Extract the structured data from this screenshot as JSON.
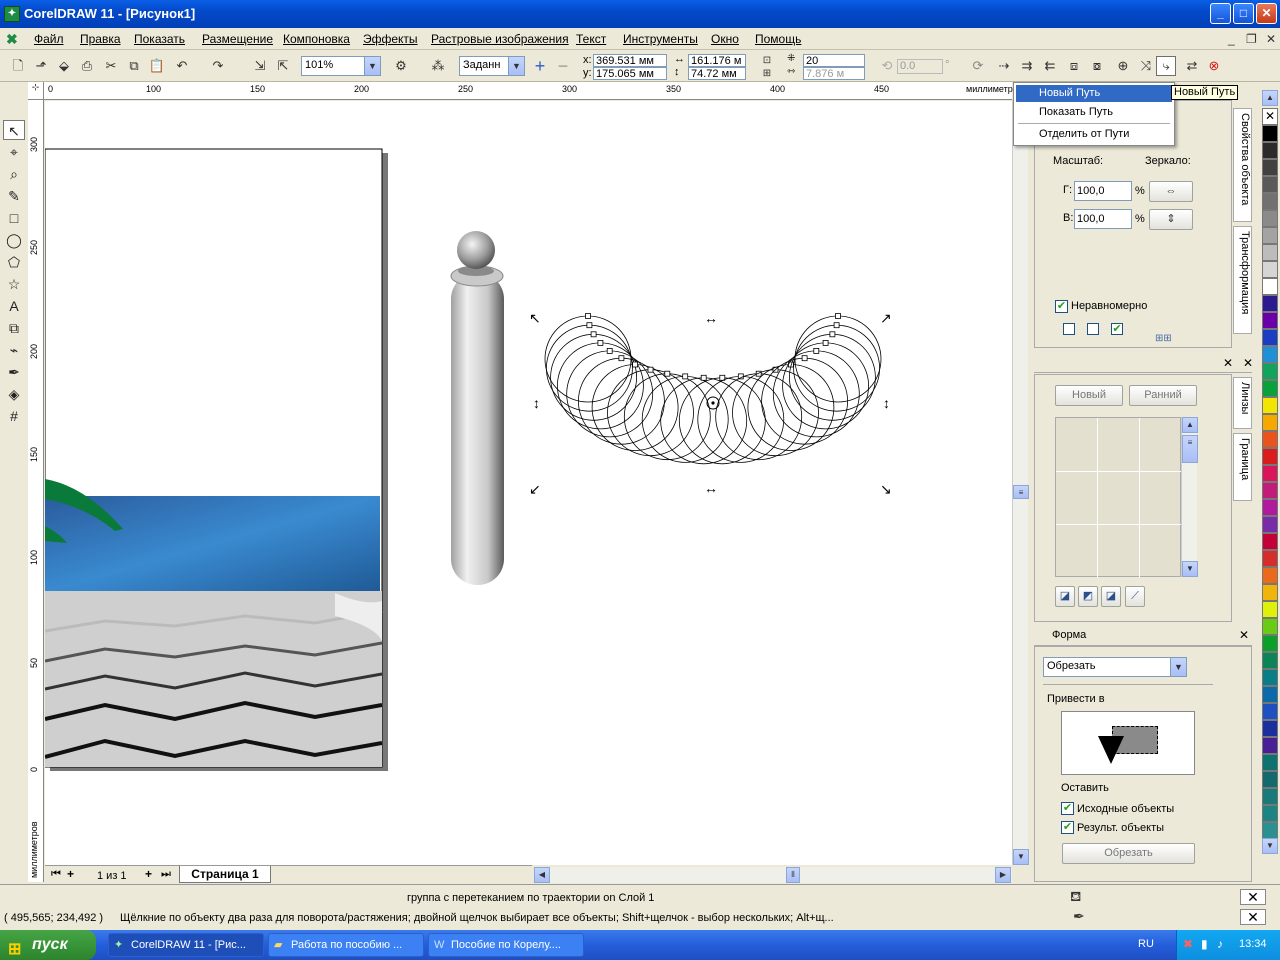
{
  "window": {
    "title": "CorelDRAW 11 - [Рисунок1]",
    "app_icon": "coreldraw-icon",
    "controls": {
      "minimize": "_",
      "maximize": "□",
      "close": "✕"
    },
    "mdi_controls": {
      "minimize": "_",
      "restore": "❐",
      "close": "✕"
    }
  },
  "menubar": {
    "items": [
      {
        "label": "Файл"
      },
      {
        "label": "Правка"
      },
      {
        "label": "Показать"
      },
      {
        "label": "Размещение"
      },
      {
        "label": "Компоновка"
      },
      {
        "label": "Эффекты"
      },
      {
        "label": "Растровые изображения"
      },
      {
        "label": "Текст"
      },
      {
        "label": "Инструменты"
      },
      {
        "label": "Окно"
      },
      {
        "label": "Помощь"
      }
    ]
  },
  "toolbar": {
    "zoom": "101%",
    "preset": "Заданн",
    "x": "369.531 мм",
    "y": "175.065 мм",
    "width": "161.176 м",
    "height": "74.72 мм",
    "steps": "20",
    "spacing": "7.876 м",
    "rotation": "0.0",
    "x_label": "x:",
    "y_label": "y:"
  },
  "ruler": {
    "h_ticks": [
      "0",
      "100",
      "150",
      "200",
      "250",
      "300",
      "350",
      "400",
      "450"
    ],
    "h_units": "миллиметр",
    "v_ticks": [
      "300",
      "250",
      "200",
      "150",
      "100",
      "50",
      "0"
    ],
    "v_units": "миллиметров"
  },
  "popup_menu": {
    "items": [
      {
        "label": "Новый Путь",
        "selected": true
      },
      {
        "label": "Показать Путь",
        "selected": false
      },
      {
        "label": "Отделить от Пути",
        "selected": false
      }
    ],
    "tooltip": "Новый Путь"
  },
  "transform_panel": {
    "scale_label": "Масштаб:",
    "mirror_label": "Зеркало:",
    "h_label": "Г:",
    "v_label": "В:",
    "h_value": "100,0",
    "v_value": "100,0",
    "percent": "%",
    "nonproportional_label": "Неравномерно",
    "nonproportional_checked": true,
    "tab_properties": "Свойства объекта",
    "tab_transform": "Трансформация"
  },
  "lines_panel": {
    "new_button": "Новый",
    "early_button": "Ранний",
    "tab_lines": "Линзы",
    "tab_border": "Граница"
  },
  "shaping_panel": {
    "title": "Форма",
    "operation": "Обрезать",
    "apply_to_label": "Привести в",
    "keep_label": "Оставить",
    "source_objects_label": "Исходные объекты",
    "source_checked": true,
    "result_objects_label": "Результ. объекты",
    "result_checked": true,
    "apply_button": "Обрезать"
  },
  "page_nav": {
    "count": "1 из 1",
    "page_tab": "Страница 1"
  },
  "status": {
    "object_info": "группа с перетеканием по траектории on Слой 1",
    "coords": "( 495,565; 234,492 )",
    "hint": "Щёлкние по объекту два раза для поворота/растяжения; двойной щелчок выбирает все объекты; Shift+щелчок - выбор нескольких; Alt+щ..."
  },
  "palette": {
    "colors": [
      "#ffffff",
      "#000000",
      "#2b2b2b",
      "#414141",
      "#5a5a5a",
      "#717171",
      "#8a8a8a",
      "#a3a3a3",
      "#bcbcbc",
      "#d5d5d5",
      "#ffffff",
      "#2c1b8f",
      "#6b00a8",
      "#1c3cc2",
      "#1f8fd6",
      "#12a35c",
      "#0aa03c",
      "#f2e600",
      "#f4a800",
      "#e8541c",
      "#d91c1c",
      "#d9165c",
      "#c21c7a",
      "#b01a9c",
      "#7a2ca8",
      "#c40038",
      "#d52c2c",
      "#e96a1c",
      "#f1b40a",
      "#dff00a",
      "#6acb16",
      "#0c9f2c",
      "#0c8458",
      "#0a7e86",
      "#0c6aa8",
      "#1e50c0",
      "#1c2f9e",
      "#4a1f96",
      "#0e7270",
      "#126a6c",
      "#1a7a7a",
      "#1d8484",
      "#2a9090"
    ]
  },
  "taskbar": {
    "start_label": "пуск",
    "tasks": [
      {
        "label": "CorelDRAW 11 - [Рис...",
        "active": true
      },
      {
        "label": "Работа по пособию ...",
        "active": false
      },
      {
        "label": "Пособие по Корелу....",
        "active": false
      }
    ],
    "lang": "RU",
    "clock": "13:34"
  }
}
